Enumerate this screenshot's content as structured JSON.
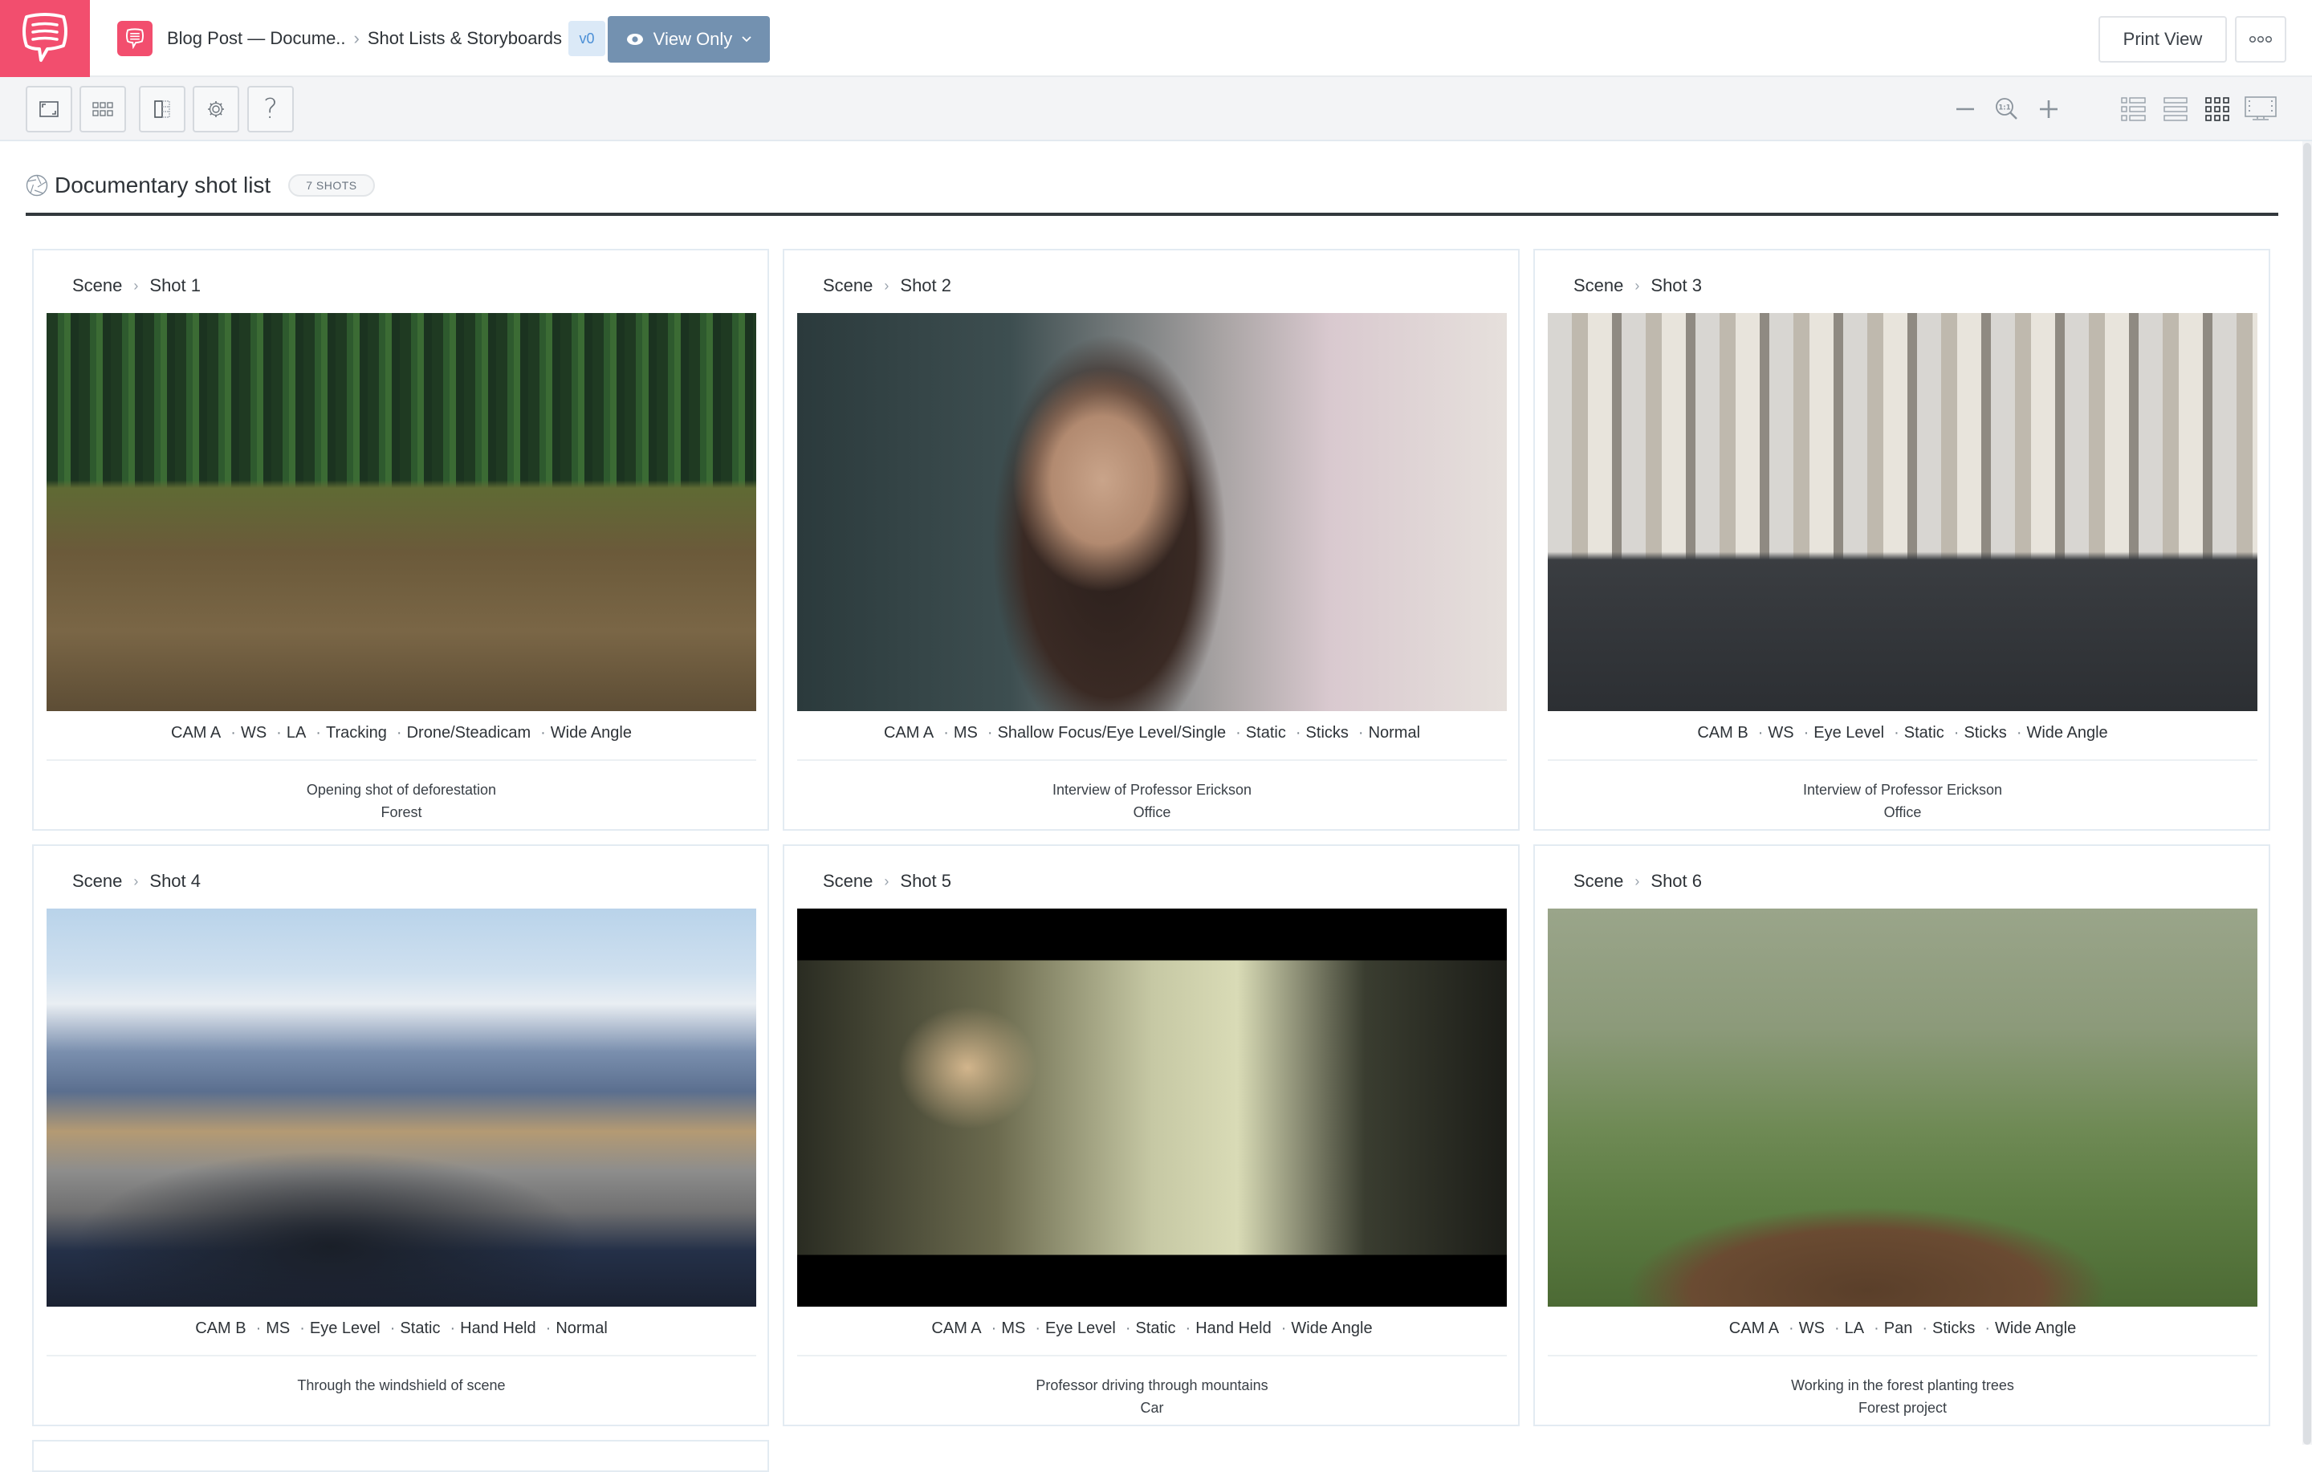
{
  "app": {
    "brand_color": "#f24e6e",
    "accent_color": "#7391b0"
  },
  "header": {
    "logo_icon": "speech-bubble-icon",
    "project_icon": "speech-bubble-icon",
    "breadcrumb": [
      "Blog Post — Docume..",
      "Shot Lists & Storyboards"
    ],
    "breadcrumb_separator": "›",
    "version_badge": "v0",
    "view_mode_label": "View Only",
    "view_mode_icon": "eye-icon",
    "print_label": "Print View",
    "more_icon": "more-dots-icon"
  },
  "toolbar": {
    "left_tools": [
      {
        "name": "fullscreen",
        "icon": "fullscreen-icon"
      },
      {
        "name": "grid",
        "icon": "grid-icon"
      },
      {
        "name": "columns",
        "icon": "columns-icon"
      },
      {
        "name": "settings",
        "icon": "gear-icon"
      },
      {
        "name": "help",
        "icon": "question-icon",
        "glyph": "?"
      }
    ],
    "zoom_controls": [
      {
        "name": "zoom-out",
        "glyph": "−"
      },
      {
        "name": "zoom-reset",
        "glyph": "1:1"
      },
      {
        "name": "zoom-in",
        "glyph": "+"
      }
    ],
    "view_modes": [
      {
        "name": "list-view",
        "active": false
      },
      {
        "name": "rows-view",
        "active": false
      },
      {
        "name": "grid-view",
        "active": true
      },
      {
        "name": "presentation-view",
        "active": false
      }
    ]
  },
  "shot_list": {
    "icon": "aperture-icon",
    "title": "Documentary shot list",
    "count_badge": "7 SHOTS",
    "shots": [
      {
        "scene": "Scene",
        "shot": "Shot 1",
        "image": "Clear-cut forest with tree stumps",
        "specs": [
          "CAM A",
          "WS",
          "LA",
          "Tracking",
          "Drone/Steadicam",
          "Wide Angle"
        ],
        "description": "Opening shot of deforestation",
        "location": "Forest"
      },
      {
        "scene": "Scene",
        "shot": "Shot 2",
        "image": "Woman speaking in interview, shallow focus",
        "specs": [
          "CAM A",
          "MS",
          "Shallow Focus/Eye Level/Single",
          "Static",
          "Sticks",
          "Normal"
        ],
        "description": "Interview of Professor Erickson",
        "location": "Office"
      },
      {
        "scene": "Scene",
        "shot": "Shot 3",
        "image": "Woman seated on stool in warehouse",
        "specs": [
          "CAM B",
          "WS",
          "Eye Level",
          "Static",
          "Sticks",
          "Wide Angle"
        ],
        "description": "Interview of Professor Erickson",
        "location": "Office"
      },
      {
        "scene": "Scene",
        "shot": "Shot 4",
        "image": "Mountain road seen through truck windshield",
        "specs": [
          "CAM B",
          "MS",
          "Eye Level",
          "Static",
          "Hand Held",
          "Normal"
        ],
        "description": "Through the windshield of scene",
        "location": ""
      },
      {
        "scene": "Scene",
        "shot": "Shot 5",
        "image": "Woman in sunglasses driving a car",
        "specs": [
          "CAM A",
          "MS",
          "Eye Level",
          "Static",
          "Hand Held",
          "Wide Angle"
        ],
        "description": "Professor driving through mountains",
        "location": "Car"
      },
      {
        "scene": "Scene",
        "shot": "Shot 6",
        "image": "Volunteers in safety vests planting trees",
        "specs": [
          "CAM A",
          "WS",
          "LA",
          "Pan",
          "Sticks",
          "Wide Angle"
        ],
        "description": "Working in the forest planting trees",
        "location": "Forest project"
      }
    ]
  }
}
